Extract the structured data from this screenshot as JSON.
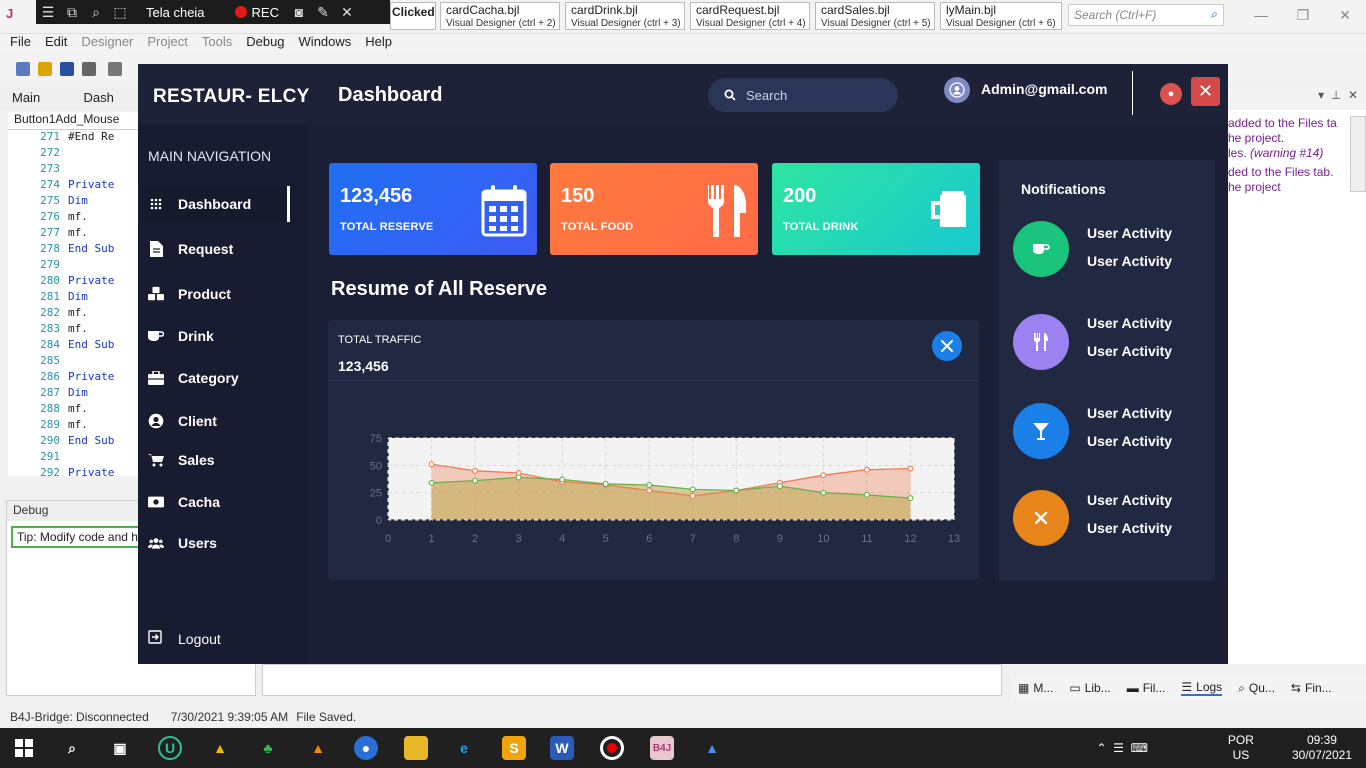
{
  "recorder": {
    "mode": "Tela cheia",
    "rec_label": "REC"
  },
  "designer_tabs": [
    {
      "name": "cardCacha.bjl",
      "sub": "Visual Designer  (ctrl + 2)"
    },
    {
      "name": "cardDrink.bjl",
      "sub": "Visual Designer  (ctrl + 3)"
    },
    {
      "name": "cardRequest.bjl",
      "sub": "Visual Designer  (ctrl + 4)"
    },
    {
      "name": "cardSales.bjl",
      "sub": "Visual Designer  (ctrl + 5)"
    },
    {
      "name": "lyMain.bjl",
      "sub": "Visual Designer  (ctrl + 6)"
    }
  ],
  "clicked_tab_label": "Clicked",
  "ide_search_placeholder": "Search (Ctrl+F)",
  "menu": [
    "File",
    "Edit",
    "Designer",
    "Project",
    "Tools",
    "Debug",
    "Windows",
    "Help"
  ],
  "ide_tabs": {
    "main": "Main",
    "dash": "Dash"
  },
  "file_tab": "Button1Add_Mouse",
  "code_lines": [
    {
      "n": "271",
      "t": "#End Re"
    },
    {
      "n": "272",
      "t": ""
    },
    {
      "n": "273",
      "t": ""
    },
    {
      "n": "274",
      "t": "Private"
    },
    {
      "n": "275",
      "t": "  Dim"
    },
    {
      "n": "276",
      "t": "  mf."
    },
    {
      "n": "277",
      "t": "  mf."
    },
    {
      "n": "278",
      "t": "End Sub"
    },
    {
      "n": "279",
      "t": ""
    },
    {
      "n": "280",
      "t": "Private"
    },
    {
      "n": "281",
      "t": "  Dim"
    },
    {
      "n": "282",
      "t": "  mf."
    },
    {
      "n": "283",
      "t": "  mf."
    },
    {
      "n": "284",
      "t": "End Sub"
    },
    {
      "n": "285",
      "t": ""
    },
    {
      "n": "286",
      "t": "Private"
    },
    {
      "n": "287",
      "t": "  Dim"
    },
    {
      "n": "288",
      "t": "  mf."
    },
    {
      "n": "289",
      "t": "  mf."
    },
    {
      "n": "290",
      "t": "End Sub"
    },
    {
      "n": "291",
      "t": ""
    },
    {
      "n": "292",
      "t": "Private"
    }
  ],
  "debug": {
    "title": "Debug",
    "tip": "Tip: Modify code and h"
  },
  "logs_panel": {
    "line1": "added to the Files ta",
    "line2": "he project.",
    "line3": "les.",
    "line3_warn": "(warning #14)",
    "line4": "ded to the Files tab.",
    "line5": "he project"
  },
  "bottom_tabs": [
    "M...",
    "Lib...",
    "Fil...",
    "Logs",
    "Qu...",
    "Fin..."
  ],
  "status": {
    "bridge": "B4J-Bridge: Disconnected",
    "timestamp": "7/30/2021 9:39:05 AM",
    "saved": "File Saved."
  },
  "taskbar": {
    "lang1": "POR",
    "lang2": "US",
    "time": "09:39",
    "date": "30/07/2021"
  },
  "app": {
    "brand": "RESTAUR- ELCY",
    "page_title": "Dashboard",
    "search_placeholder": "Search",
    "user_email": "Admin@gmail.com",
    "nav_heading": "MAIN NAVIGATION",
    "nav": [
      "Dashboard",
      "Request",
      "Product",
      "Drink",
      "Category",
      "Client",
      "Sales",
      "Cacha",
      "Users"
    ],
    "logout": "Logout",
    "cards": {
      "reserve": {
        "value": "123,456",
        "label": "TOTAL RESERVE"
      },
      "food": {
        "value": "150",
        "label": "TOTAL FOOD"
      },
      "drink": {
        "value": "200",
        "label": "TOTAL DRINK"
      }
    },
    "section_title": "Resume of All Reserve",
    "traffic_label": "TOTAL TRAFFIC",
    "traffic_value": "123,456",
    "notifications_title": "Notifications",
    "notif_text": "User Activity",
    "accent_colors": {
      "blue": "#2f63f3",
      "orange": "#ff7040",
      "teal": "#1fd4b8",
      "green": "#1bc47d",
      "purple": "#9c82f0",
      "cyan_blue": "#1a7fe6",
      "amber": "#e8851a"
    }
  },
  "chart_data": {
    "type": "area",
    "x": [
      1,
      2,
      3,
      4,
      5,
      6,
      7,
      8,
      9,
      10,
      11,
      12
    ],
    "series": [
      {
        "values": [
          51,
          45,
          43,
          35,
          32,
          27,
          22,
          27,
          34,
          41,
          46,
          47
        ],
        "color": "#f07c54"
      },
      {
        "values": [
          34,
          36,
          39,
          37,
          33,
          32,
          28,
          27,
          31,
          25,
          23,
          20
        ],
        "color": "#6ab04c"
      }
    ],
    "xlim": [
      0,
      13
    ],
    "ylim": [
      0,
      75
    ],
    "xticks": [
      "0",
      "1",
      "2",
      "3",
      "4",
      "5",
      "6",
      "7",
      "8",
      "9",
      "10",
      "11",
      "12",
      "13"
    ],
    "yticks": [
      "0",
      "25",
      "50",
      "75"
    ],
    "grid": true
  }
}
